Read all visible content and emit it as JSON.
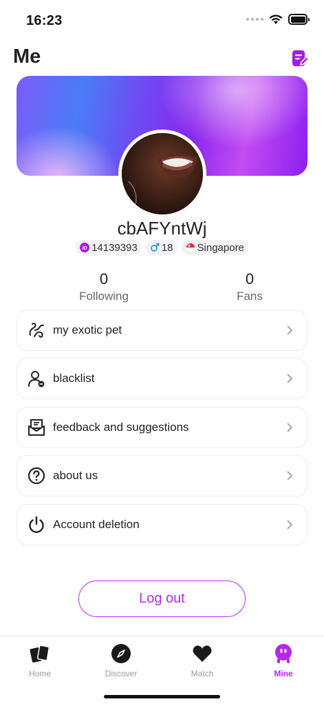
{
  "status_bar": {
    "time": "16:23"
  },
  "header": {
    "title": "Me",
    "edit_icon": "edit-note-icon"
  },
  "profile": {
    "username": "cbAFYntWj",
    "id": "14139393",
    "age": "18",
    "country": "Singapore",
    "gender_icon": "male-icon",
    "flag_icon": "singapore-flag-icon"
  },
  "stats": [
    {
      "value": "0",
      "label": "Following"
    },
    {
      "value": "0",
      "label": "Fans"
    }
  ],
  "menu": [
    {
      "label": "my exotic pet",
      "icon": "pet-icon"
    },
    {
      "label": "blacklist",
      "icon": "user-block-icon"
    },
    {
      "label": "feedback and suggestions",
      "icon": "mail-feedback-icon"
    },
    {
      "label": "about us",
      "icon": "question-icon"
    },
    {
      "label": "Account deletion",
      "icon": "power-icon"
    }
  ],
  "logout_label": "Log out",
  "tabs": [
    {
      "label": "Home",
      "icon": "cards-icon",
      "active": false
    },
    {
      "label": "Discover",
      "icon": "compass-icon",
      "active": false
    },
    {
      "label": "Match",
      "icon": "heart-icon",
      "active": false
    },
    {
      "label": "Mine",
      "icon": "mine-face-icon",
      "active": true
    }
  ],
  "colors": {
    "accent": "#b528e8",
    "banner_start": "#4a7df6",
    "banner_end": "#8c1ff0"
  }
}
